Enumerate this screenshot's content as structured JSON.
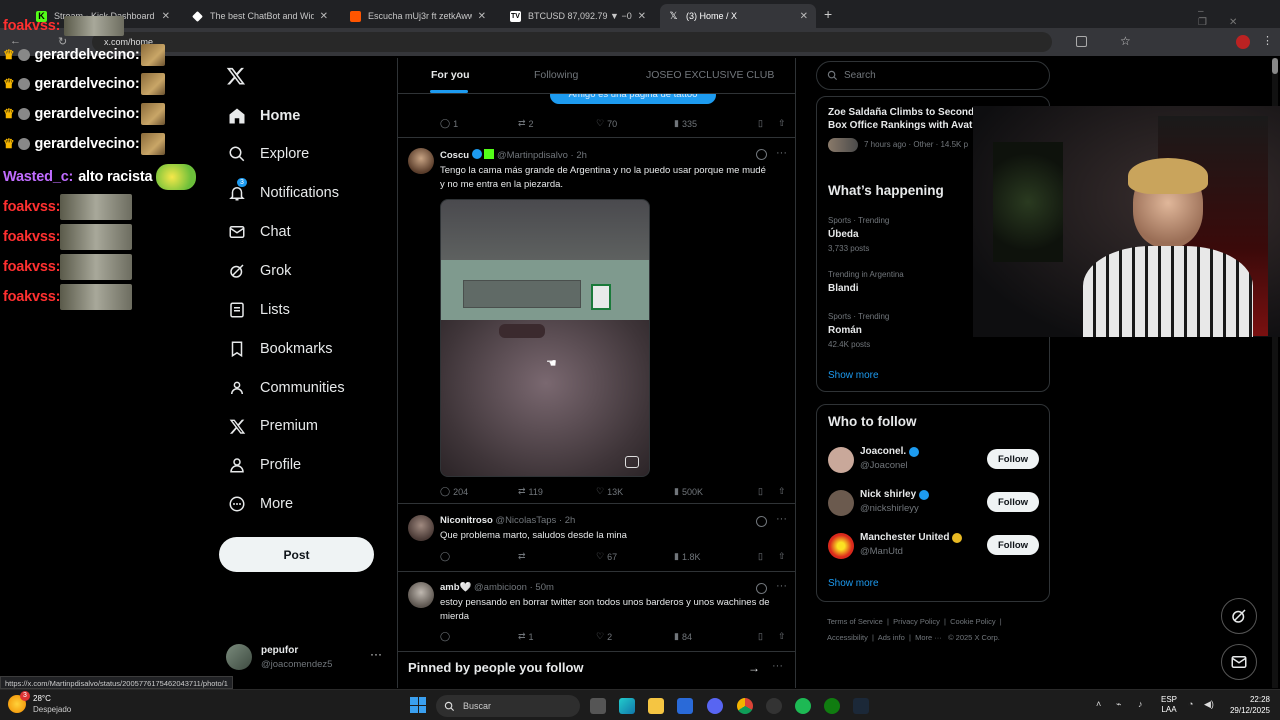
{
  "browser": {
    "tabs": [
      {
        "title": "Stream - Kick Dashboard",
        "color": "#53fc18"
      },
      {
        "title": "The best ChatBot and Widgets",
        "color": "#ffffff"
      },
      {
        "title": "Escucha mUj3r ft zetkAww de g",
        "color": "#ff5500"
      },
      {
        "title": "BTCUSD 87,092.79 ▼ −0.1% Sin",
        "color": "#2a2e39"
      },
      {
        "title": "(3) Home / X",
        "color": "#000000"
      }
    ],
    "url": "x.com/home",
    "status_url": "https://x.com/Martinpdisalvo/status/2005776175462043711/photo/1"
  },
  "chat_overlay": [
    {
      "user": "gerardelvecino:",
      "color": "#ffffff"
    },
    {
      "user": "gerardelvecino:",
      "color": "#ffffff"
    },
    {
      "user": "gerardelvecino:",
      "color": "#ffffff"
    },
    {
      "user": "gerardelvecino:",
      "color": "#ffffff"
    },
    {
      "user": "Wasted_c:",
      "message": "alto racista",
      "color": "#c06cff"
    },
    {
      "user": "foakvss:",
      "color": "#ff3030"
    },
    {
      "user": "foakvss:",
      "color": "#ff3030"
    },
    {
      "user": "foakvss:",
      "color": "#ff3030"
    },
    {
      "user": "foakvss:",
      "color": "#ff3030"
    }
  ],
  "nav": {
    "items": [
      {
        "label": "Home",
        "icon": "home-icon"
      },
      {
        "label": "Explore",
        "icon": "search-icon"
      },
      {
        "label": "Notifications",
        "icon": "bell-icon",
        "badge": "3"
      },
      {
        "label": "Chat",
        "icon": "mail-icon"
      },
      {
        "label": "Grok",
        "icon": "grok-icon"
      },
      {
        "label": "Lists",
        "icon": "list-icon"
      },
      {
        "label": "Bookmarks",
        "icon": "bookmark-icon"
      },
      {
        "label": "Communities",
        "icon": "communities-icon"
      },
      {
        "label": "Premium",
        "icon": "x-logo-icon"
      },
      {
        "label": "Profile",
        "icon": "person-icon"
      },
      {
        "label": "More",
        "icon": "more-circle-icon"
      }
    ],
    "post_label": "Post",
    "account": {
      "name": "pepufor",
      "handle": "@joacomendez5"
    }
  },
  "feed": {
    "tabs": [
      "For you",
      "Following",
      "JOSEO EXCLUSIVE CLUB"
    ],
    "prev_post": {
      "pill_text": "Amigo es una pagina de tattoo",
      "replies": "1",
      "reposts": "2",
      "likes": "70",
      "views": "335"
    },
    "posts": [
      {
        "name": "Coscu",
        "handle": "@Martinpdisalvo",
        "time": "· 2h",
        "text": "Tengo la cama más grande de Argentina y no la puedo usar porque me mudé y no me entra en la piezarda.",
        "replies": "204",
        "reposts": "119",
        "likes": "13K",
        "views": "500K"
      },
      {
        "name": "Niconitroso",
        "handle": "@NicolasTaps",
        "time": "· 2h",
        "text": "Que problema marto, saludos desde la mina",
        "replies": "",
        "reposts": "",
        "likes": "67",
        "views": "1.8K"
      },
      {
        "name": "amb🤍",
        "handle": "@ambicioon",
        "time": "· 50m",
        "text": "estoy pensando en borrar twitter son todos unos barderos y unos wachines de mierda",
        "replies": "",
        "reposts": "1",
        "likes": "2",
        "views": "84"
      }
    ],
    "pinned_title": "Pinned by people you follow"
  },
  "right": {
    "search_placeholder": "Search",
    "news": {
      "title": "Zoe Saldaña Climbs to Second Box Office Rankings with Avat",
      "meta": "7 hours ago · Other · 14.5K p"
    },
    "whats_happening": "What’s happening",
    "trends": [
      {
        "meta": "Sports · Trending",
        "name": "Úbeda",
        "posts": "3,733 posts"
      },
      {
        "meta": "Trending in Argentina",
        "name": "Blandi",
        "posts": ""
      },
      {
        "meta": "Sports · Trending",
        "name": "Román",
        "posts": "42.4K posts"
      }
    ],
    "show_more": "Show more",
    "who_to_follow": "Who to follow",
    "follow_label": "Follow",
    "suggestions": [
      {
        "name": "Joaconel.",
        "handle": "@Joaconel",
        "avatar_color": "#c9a89a"
      },
      {
        "name": "Nick shirley",
        "handle": "@nickshirleyy",
        "avatar_color": "#6b5a4e"
      },
      {
        "name": "Manchester United",
        "handle": "@ManUtd",
        "avatar_color": "#da291c"
      }
    ],
    "footer_links": [
      "Terms of Service",
      "Privacy Policy",
      "Cookie Policy",
      "Accessibility",
      "Ads info",
      "More ···",
      "© 2025 X Corp."
    ]
  },
  "taskbar": {
    "weather_temp": "28°C",
    "weather_desc": "Despejado",
    "search_placeholder": "Buscar",
    "lang": "ESP",
    "lang_sub": "LAA",
    "time": "22:28",
    "date": "29/12/2025",
    "weather_badge": "3"
  },
  "colors": {
    "accent": "#1d9bf0",
    "verified_gold": "#e8b923"
  }
}
